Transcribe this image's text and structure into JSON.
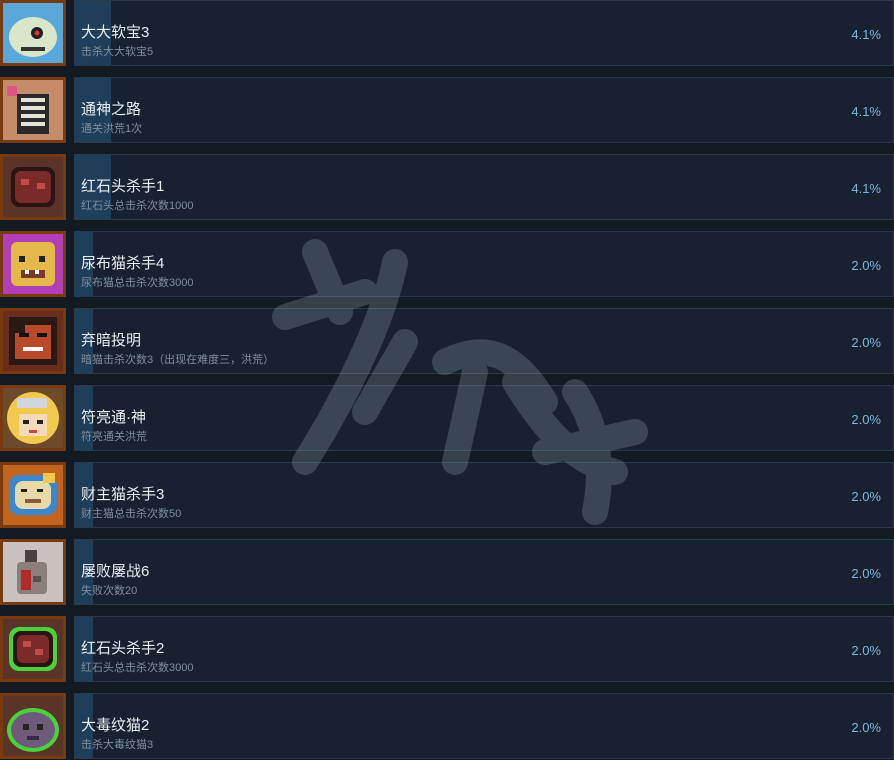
{
  "achievements": [
    {
      "title": "大大软宝3",
      "desc": "击杀大大软宝5",
      "percent": "4.1%",
      "icon": "slime-icon",
      "icon_color": "#d9e7c8",
      "fill_fraction": 0.041
    },
    {
      "title": "通神之路",
      "desc": "通关洪荒1次",
      "percent": "4.1%",
      "icon": "stairs-icon",
      "icon_color": "#e8e3d6",
      "fill_fraction": 0.041
    },
    {
      "title": "红石头杀手1",
      "desc": "红石头总击杀次数1000",
      "percent": "4.1%",
      "icon": "red-rock-icon",
      "icon_color": "#7b2a2a",
      "fill_fraction": 0.041
    },
    {
      "title": "尿布猫杀手4",
      "desc": "尿布猫总击杀次数3000",
      "percent": "2.0%",
      "icon": "diaper-cat-icon",
      "icon_color": "#e5b84a",
      "fill_fraction": 0.02
    },
    {
      "title": "弃暗投明",
      "desc": "暗猫击杀次数3（出现在难度三，洪荒）",
      "percent": "2.0%",
      "icon": "dark-cat-icon",
      "icon_color": "#4a2a1c",
      "fill_fraction": 0.02
    },
    {
      "title": "符亮通·神",
      "desc": "符亮通关洪荒",
      "percent": "2.0%",
      "icon": "blonde-hero-icon",
      "icon_color": "#f2c94c",
      "fill_fraction": 0.02
    },
    {
      "title": "财主猫杀手3",
      "desc": "财主猫总击杀次数50",
      "percent": "2.0%",
      "icon": "rich-cat-icon",
      "icon_color": "#e9d9a6",
      "fill_fraction": 0.02
    },
    {
      "title": "屡败屡战6",
      "desc": "失败次数20",
      "percent": "2.0%",
      "icon": "defeated-cat-icon",
      "icon_color": "#8a7f7a",
      "fill_fraction": 0.02
    },
    {
      "title": "红石头杀手2",
      "desc": "红石头总击杀次数3000",
      "percent": "2.0%",
      "icon": "red-rock-green-icon",
      "icon_color": "#7b2a2a",
      "fill_fraction": 0.02
    },
    {
      "title": "大毒纹猫2",
      "desc": "击杀大毒纹猫3",
      "percent": "2.0%",
      "icon": "poison-cat-icon",
      "icon_color": "#6e5a7a",
      "fill_fraction": 0.02
    }
  ],
  "colors": {
    "background": "#131a22",
    "row_background": "#172130",
    "progress_fill": "#1f3e5a",
    "percent_text": "#7ab6e0",
    "frame_orange": "#c0641e"
  }
}
